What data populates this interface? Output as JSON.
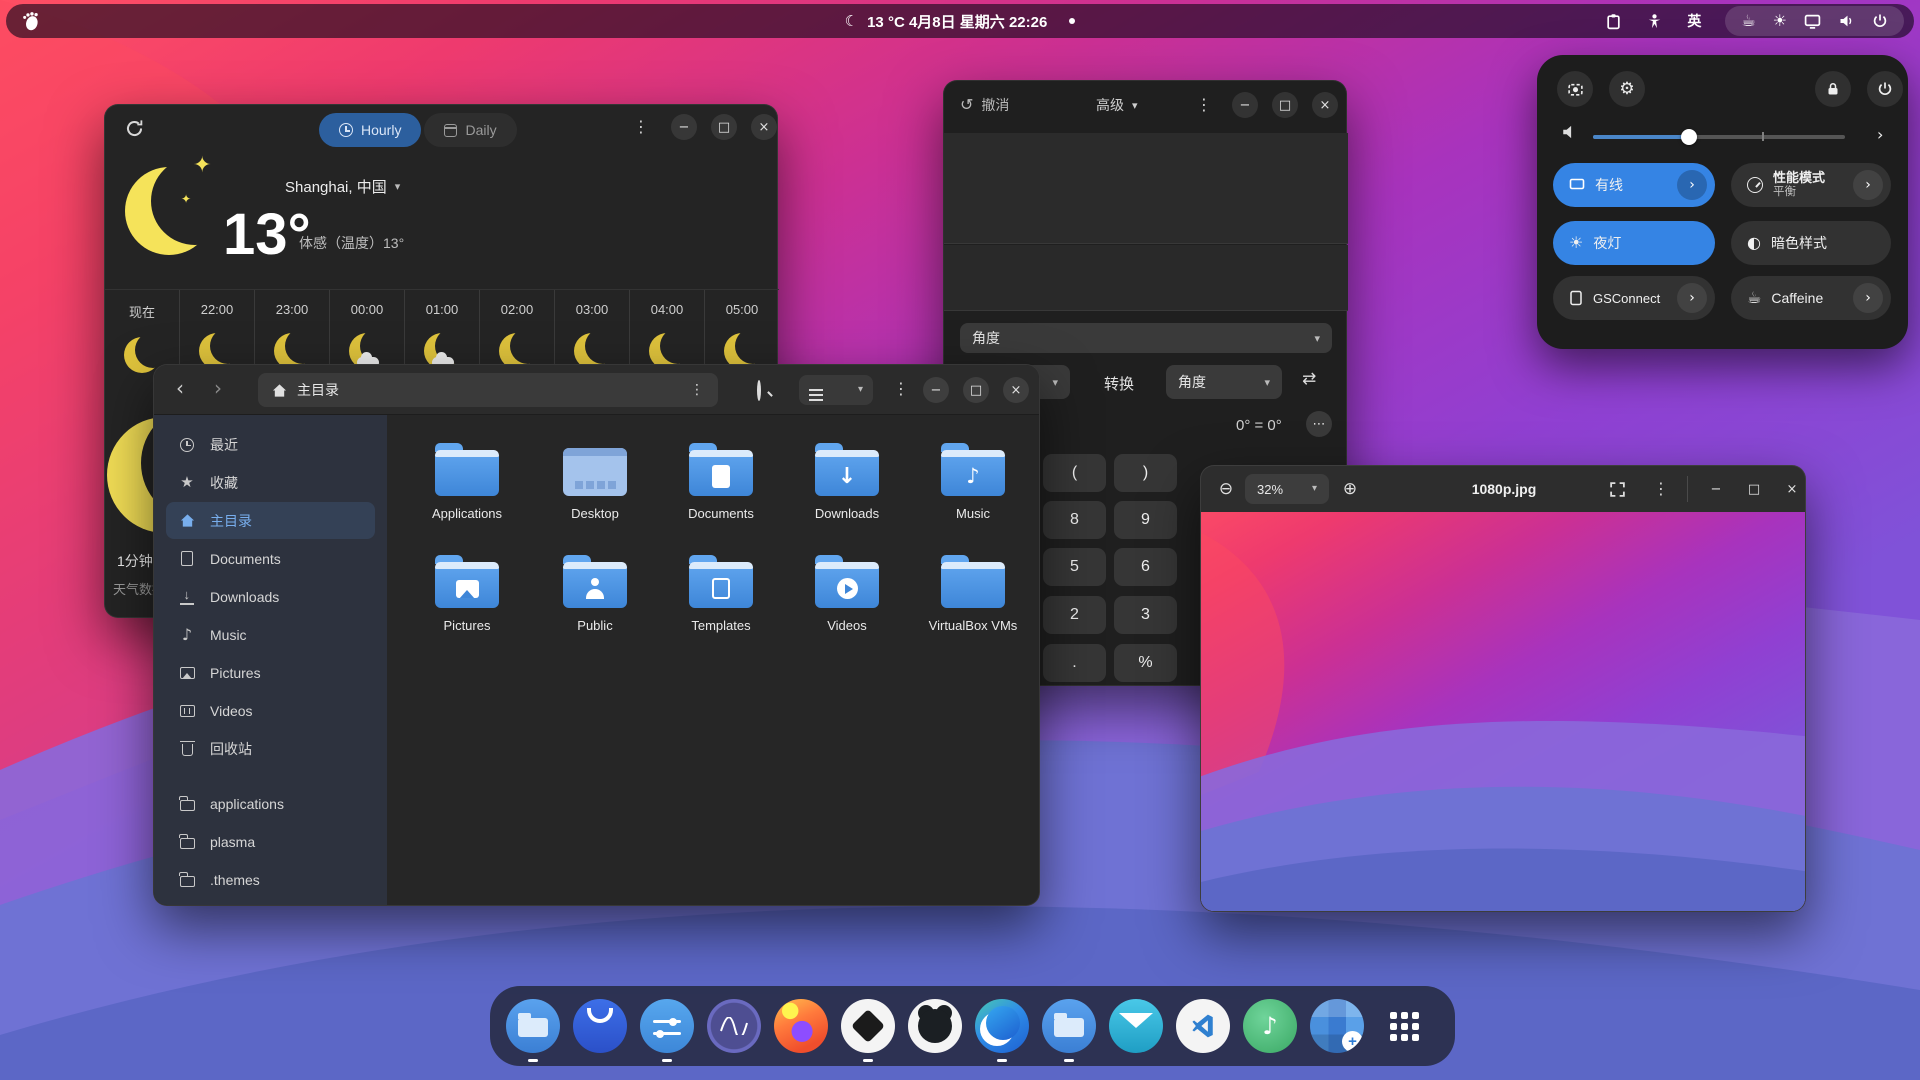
{
  "glyphs": {
    "moon": "☾",
    "sun": "☀",
    "cup": "☕",
    "gear": "⚙",
    "contrast": "◐",
    "swap": "⇄",
    "undo": "↺",
    "kebab": "⋮",
    "ellipsis": "⋯",
    "chevron_down": "▾",
    "chevron_right": "›",
    "back": "‹",
    "forward": "›",
    "minimize": "−",
    "maximize": "□",
    "close": "×",
    "star": "★",
    "zoom_out": "⊖",
    "zoom_in": "⊕",
    "note": "♪",
    "divider": "|"
  },
  "topbar": {
    "clock": "13 °C  4月8日 星期六  22:26",
    "input_method": "英"
  },
  "weather": {
    "tabs": {
      "hourly": "Hourly",
      "daily": "Daily"
    },
    "location": "Shanghai, 中国",
    "temperature": "13°",
    "feels_like": "体感（温度）13°",
    "hours": [
      {
        "time": "现在",
        "icon": "moon"
      },
      {
        "time": "22:00",
        "icon": "moon"
      },
      {
        "time": "23:00",
        "icon": "moon"
      },
      {
        "time": "00:00",
        "icon": "moon-cloud"
      },
      {
        "time": "01:00",
        "icon": "moon-cloud"
      },
      {
        "time": "02:00",
        "icon": "moon"
      },
      {
        "time": "03:00",
        "icon": "moon"
      },
      {
        "time": "04:00",
        "icon": "moon"
      },
      {
        "time": "05:00",
        "icon": "moon"
      }
    ],
    "updated": "1分钟前",
    "attribution": "天气数据"
  },
  "files": {
    "path": "主目录",
    "sidebar": [
      {
        "label": "最近"
      },
      {
        "label": "收藏"
      },
      {
        "label": "主目录"
      },
      {
        "label": "Documents"
      },
      {
        "label": "Downloads"
      },
      {
        "label": "Music"
      },
      {
        "label": "Pictures"
      },
      {
        "label": "Videos"
      },
      {
        "label": "回收站"
      },
      {
        "label": "applications"
      },
      {
        "label": "plasma"
      },
      {
        "label": ".themes"
      }
    ],
    "grid": [
      {
        "label": "Applications"
      },
      {
        "label": "Desktop"
      },
      {
        "label": "Documents"
      },
      {
        "label": "Downloads"
      },
      {
        "label": "Music"
      },
      {
        "label": "Pictures"
      },
      {
        "label": "Public"
      },
      {
        "label": "Templates"
      },
      {
        "label": "Videos"
      },
      {
        "label": "VirtualBox VMs"
      }
    ]
  },
  "calculator": {
    "undo_label": "撤消",
    "mode": "高级",
    "panel_unit": "角度",
    "convert_label": "转换",
    "unit_to": "角度",
    "equation": "0° = 0°",
    "keys": [
      [
        "(",
        ")"
      ],
      [
        "8",
        "9"
      ],
      [
        "5",
        "6"
      ],
      [
        "2",
        "3"
      ],
      [
        ".",
        "%"
      ]
    ]
  },
  "viewer": {
    "zoom_level": "32%",
    "title": "1080p.jpg"
  },
  "quick_settings": {
    "wired": "有线",
    "performance": "性能模式",
    "performance_sub": "平衡",
    "night_light": "夜灯",
    "dark_style": "暗色样式",
    "gsconnect": "GSConnect",
    "caffeine": "Caffeine"
  },
  "dock": {
    "icons": [
      "files",
      "web-app",
      "settings-sliders",
      "system-monitor",
      "firefox",
      "inkscape",
      "github",
      "edge",
      "file-manager",
      "mail",
      "vscode",
      "music",
      "software",
      "app-grid"
    ]
  },
  "colors": {
    "accent": "#3584e4",
    "folder_blue": "#4e96e4",
    "moon_yellow": "#f5e35a",
    "active_tab": "#2c5f9e"
  }
}
